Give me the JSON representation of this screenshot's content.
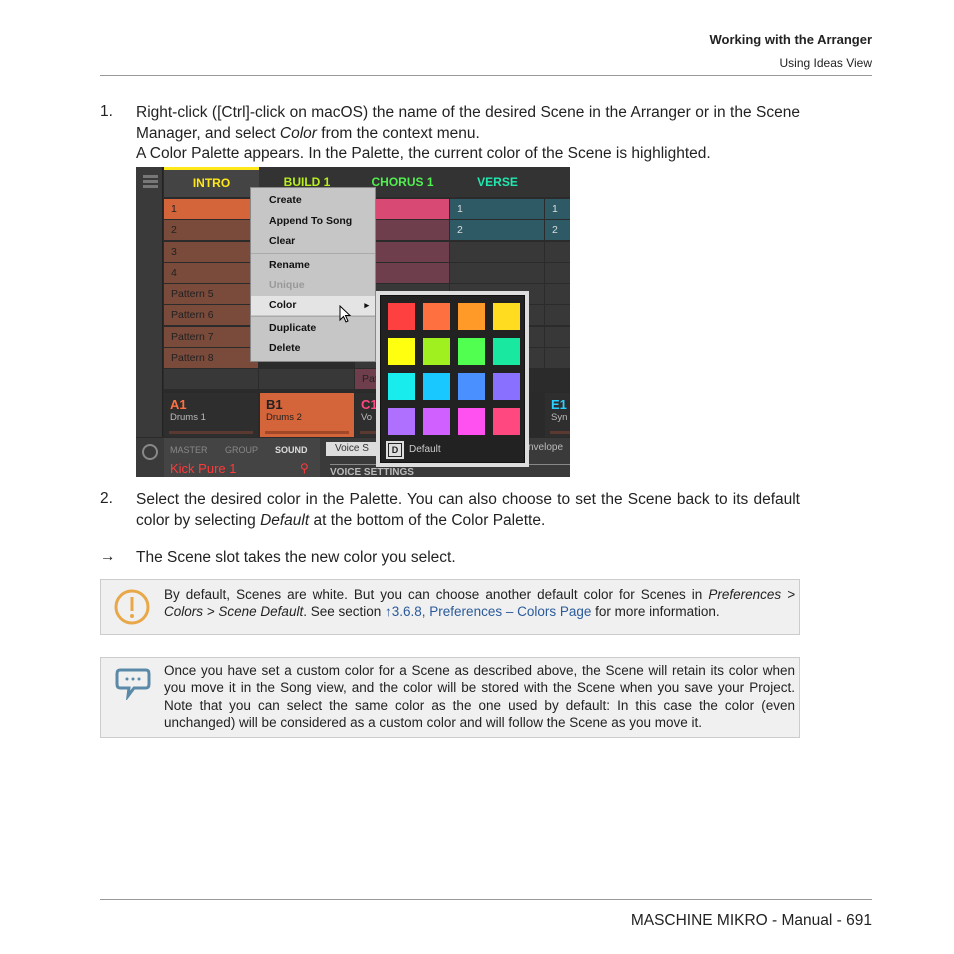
{
  "header": {
    "title": "Working with the Arranger",
    "subtitle": "Using Ideas View"
  },
  "steps": [
    {
      "num": "1.",
      "text_parts": [
        "Right-click ([Ctrl]-click on macOS) the name of the desired Scene in the Arranger or in the Scene Manager, and select ",
        "Color",
        " from the context menu."
      ],
      "result": "A Color Palette appears. In the Palette, the current color of the Scene is highlighted."
    },
    {
      "num": "2.",
      "text_parts": [
        "Select the desired color in the Palette. You can also choose to set the Scene back to its default color by selecting ",
        "Default",
        " at the bottom of the Color Palette."
      ]
    }
  ],
  "result_arrow": "→",
  "result_text": "The Scene slot takes the new color you select.",
  "notes": [
    {
      "icon": "exclamation-icon",
      "parts": [
        "By default, Scenes are white. But you can choose another default color for Scenes in ",
        "Preferences > Colors > Scene Default",
        ". See section ",
        "↑3.6.8, Preferences – Colors Page",
        " for more information."
      ]
    },
    {
      "icon": "speech-bubble-icon",
      "text": "Once you have set a custom color for a Scene as described above, the Scene will retain its color when you move it in the Song view, and the color will be stored with the Scene when you save your Project. Note that you can select the same color as the one used by default: In this case the color (even unchanged) will be considered as a custom color and will follow the Scene as you move it."
    }
  ],
  "footer": "MASCHINE MIKRO - Manual - 691",
  "screenshot": {
    "scenes": [
      {
        "label": "INTRO",
        "color": "#ffe81a"
      },
      {
        "label": "BUILD 1",
        "color": "#b8f020"
      },
      {
        "label": "CHORUS 1",
        "color": "#50f050"
      },
      {
        "label": "VERSE",
        "color": "#20e8b0"
      }
    ],
    "intro_patterns": [
      "1",
      "2",
      "3",
      "4",
      "Pattern 5",
      "Pattern 6",
      "Pattern 7",
      "Pattern 8"
    ],
    "verse_patterns": [
      "1",
      "2"
    ],
    "extra_patterns": [
      "1",
      "2"
    ],
    "chorus_partial": "Pat",
    "groups": [
      {
        "id": "A1",
        "name": "Drums 1"
      },
      {
        "id": "B1",
        "name": "Drums 2"
      },
      {
        "id": "C1",
        "name": "Vo"
      },
      {
        "id": "E1",
        "name": "Syn"
      }
    ],
    "bottom_tabs": [
      "MASTER",
      "GROUP",
      "SOUND"
    ],
    "sound_name": "Kick Pure 1",
    "voice_tab": "Voice S",
    "voice_settings": "VOICE SETTINGS",
    "envelope_tab": "nvelope",
    "menu": {
      "items": [
        "Create",
        "Append To Song",
        "Clear",
        "Rename",
        "Unique",
        "Color",
        "Duplicate",
        "Delete"
      ],
      "disabled": "Unique",
      "highlighted": "Color"
    },
    "palette": {
      "colors": [
        "#ff4040",
        "#ff7040",
        "#ff9a28",
        "#ffdc20",
        "#ffff10",
        "#a0f020",
        "#50ff50",
        "#18e8a0",
        "#18ecec",
        "#18c8ff",
        "#4a90ff",
        "#8a70ff",
        "#b070ff",
        "#d060ff",
        "#ff50f0",
        "#ff4880"
      ],
      "default_key": "D",
      "default_label": "Default"
    }
  }
}
